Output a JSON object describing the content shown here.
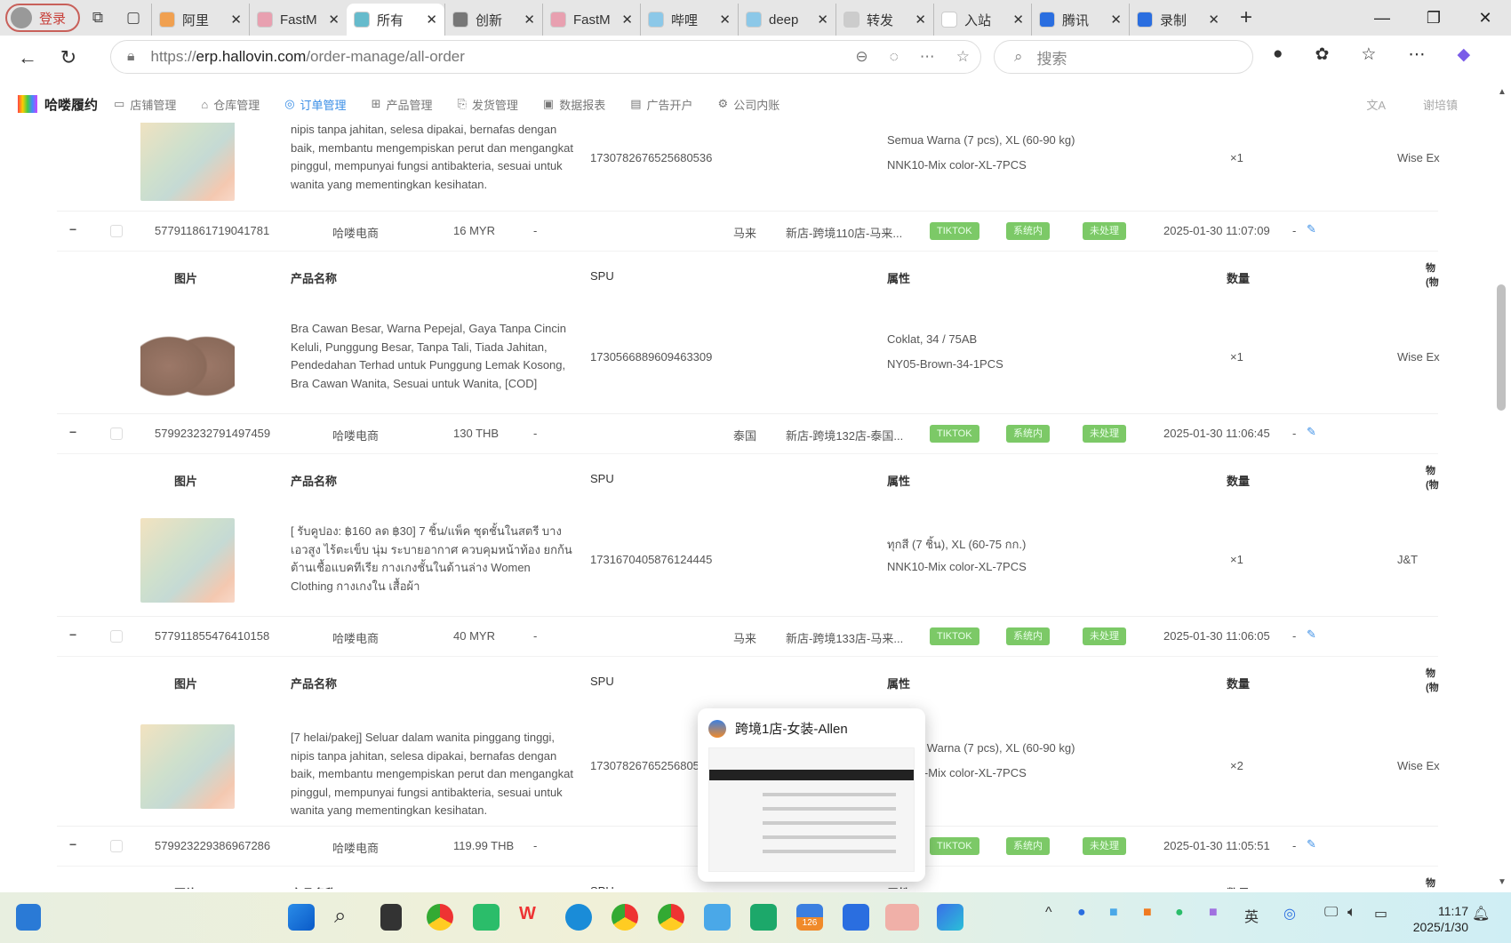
{
  "browser": {
    "login_label": "登录",
    "tabs": [
      {
        "label": "阿里",
        "color": "#f0a050"
      },
      {
        "label": "FastM",
        "color": "#e8a0b0"
      },
      {
        "label": "所有",
        "color": "#6bc",
        "active": true
      },
      {
        "label": "创新",
        "color": "#777"
      },
      {
        "label": "FastM",
        "color": "#e8a0b0"
      },
      {
        "label": "哔哩",
        "color": "#8cc8e8"
      },
      {
        "label": "deep",
        "color": "#8cc8e8"
      },
      {
        "label": "转发",
        "color": "#ccc"
      },
      {
        "label": "入站",
        "color": "#fff"
      },
      {
        "label": "腾讯",
        "color": "#2a6ee0"
      },
      {
        "label": "录制",
        "color": "#2a6ee0"
      }
    ],
    "url_prefix": "https://",
    "url_domain": "erp.hallovin.com",
    "url_path": "/order-manage/all-order",
    "search_placeholder": "搜索"
  },
  "app": {
    "logo_text": "哈喽履约",
    "menu": [
      {
        "label": "店铺管理",
        "icon": "store-icon"
      },
      {
        "label": "仓库管理",
        "icon": "warehouse-icon"
      },
      {
        "label": "订单管理",
        "icon": "order-icon",
        "active": true
      },
      {
        "label": "产品管理",
        "icon": "product-icon"
      },
      {
        "label": "发货管理",
        "icon": "shipping-icon"
      },
      {
        "label": "数据报表",
        "icon": "report-icon"
      },
      {
        "label": "广告开户",
        "icon": "ad-icon"
      },
      {
        "label": "公司内账",
        "icon": "accounting-icon"
      }
    ],
    "translate_icon": "文A",
    "user_label": "谢培镇"
  },
  "table": {
    "sub_headers": {
      "image": "图片",
      "name": "产品名称",
      "spu": "SPU",
      "attr": "属性",
      "qty": "数量",
      "last": "物(物"
    },
    "products": [
      {
        "name": "nipis tanpa jahitan, selesa dipakai, bernafas dengan baik, membantu mengempiskan perut dan mengangkat pinggul, mempunyai fungsi antibakteria, sesuai untuk wanita yang mementingkan kesihatan.",
        "spu": "1730782676525680536",
        "attr1": "Semua Warna (7 pcs), XL (60-90 kg)",
        "attr2": "NNK10-Mix color-XL-7PCS",
        "qty": "×1",
        "logistics": "Wise Ex"
      },
      {
        "name": "Bra Cawan Besar, Warna Pepejal, Gaya Tanpa Cincin Keluli, Punggung Besar, Tanpa Tali, Tiada Jahitan, Pendedahan Terhad untuk Punggung Lemak Kosong, Bra Cawan Wanita, Sesuai untuk Wanita, [COD]",
        "spu": "1730566889609463309",
        "attr1": "Coklat, 34 / 75AB",
        "attr2": "NY05-Brown-34-1PCS",
        "qty": "×1",
        "logistics": "Wise Ex"
      },
      {
        "name": "[ รับคูปอง: ฿160 ลด ฿30] 7 ชิ้น/แพ็ค ชุดชั้นในสตรี บาง เอวสูง ไร้ตะเข็บ นุ่ม ระบายอากาศ ควบคุมหน้าท้อง ยกก้น ต้านเชื้อแบคทีเรีย กางเกงชั้นในด้านล่าง Women Clothing กางเกงใน เสื้อผ้า",
        "spu": "1731670405876124445",
        "attr1": "ทุกสี (7 ชิ้น), XL (60-75 กก.)",
        "attr2": "NNK10-Mix color-XL-7PCS",
        "qty": "×1",
        "logistics": "J&T"
      },
      {
        "name": "[7 helai/pakej] Seluar dalam wanita pinggang tinggi, nipis tanpa jahitan, selesa dipakai, bernafas dengan baik, membantu mengempiskan perut dan mengangkat pinggul, mempunyai fungsi antibakteria, sesuai untuk wanita yang mementingkan kesihatan.",
        "spu": "17307826765256805",
        "attr1": "Semua Warna (7 pcs), XL (60-90 kg)",
        "attr2": "NNK10-Mix color-XL-7PCS",
        "qty": "×2",
        "logistics": "Wise Ex"
      }
    ],
    "orders": [
      {
        "id": "577911861719041781",
        "shop_group": "哈喽电商",
        "amount": "16 MYR",
        "dash": "-",
        "country": "马来",
        "store": "新店-跨境110店-马来...",
        "platform": "TIKTOK",
        "tag": "系统内",
        "status": "未处理",
        "time": "2025-01-30 11:07:09"
      },
      {
        "id": "579923232791497459",
        "shop_group": "哈喽电商",
        "amount": "130 THB",
        "dash": "-",
        "country": "泰国",
        "store": "新店-跨境132店-泰国...",
        "platform": "TIKTOK",
        "tag": "系统内",
        "status": "未处理",
        "time": "2025-01-30 11:06:45"
      },
      {
        "id": "577911855476410158",
        "shop_group": "哈喽电商",
        "amount": "40 MYR",
        "dash": "-",
        "country": "马来",
        "store": "新店-跨境133店-马来...",
        "platform": "TIKTOK",
        "tag": "系统内",
        "status": "未处理",
        "time": "2025-01-30 11:06:05"
      },
      {
        "id": "579923229386967286",
        "shop_group": "哈喽电商",
        "amount": "119.99 THB",
        "dash": "-",
        "country": "",
        "store": "",
        "platform": "TIKTOK",
        "tag": "系统内",
        "status": "未处理",
        "time": "2025-01-30 11:05:51"
      }
    ],
    "edit_dash": "-"
  },
  "popup": {
    "title": "跨境1店-女装-Allen"
  },
  "taskbar": {
    "time": "11:17",
    "date": "2025/1/30",
    "badge_126": "126"
  }
}
